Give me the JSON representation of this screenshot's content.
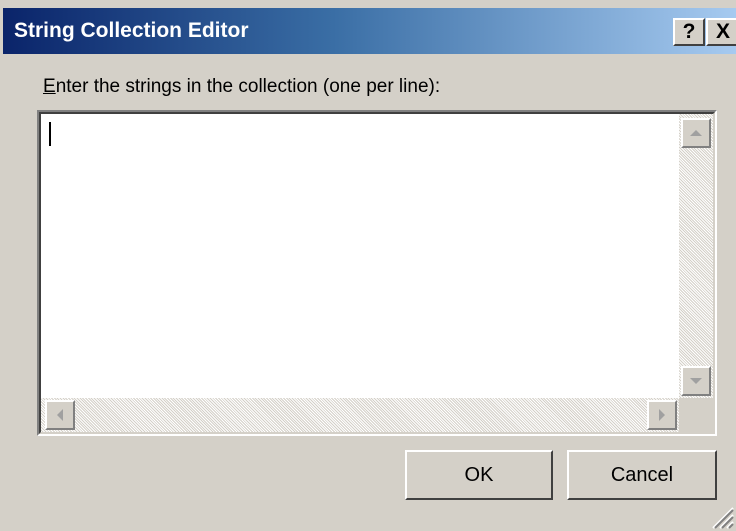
{
  "window": {
    "title": "String Collection Editor",
    "help_label": "?",
    "close_label": "X"
  },
  "prompt": {
    "accelerator": "E",
    "rest": "nter the strings in the collection (one per line):"
  },
  "textbox": {
    "value": ""
  },
  "buttons": {
    "ok_label": "OK",
    "cancel_label": "Cancel"
  },
  "icons": {
    "help": "help-icon",
    "close": "close-icon",
    "scroll_up": "arrow-up-icon",
    "scroll_down": "arrow-down-icon",
    "scroll_left": "arrow-left-icon",
    "scroll_right": "arrow-right-icon",
    "resize_grip": "resize-grip-icon"
  },
  "colors": {
    "titlebar_start": "#0a246a",
    "titlebar_end": "#a6caf0",
    "face": "#d4d0c8"
  }
}
